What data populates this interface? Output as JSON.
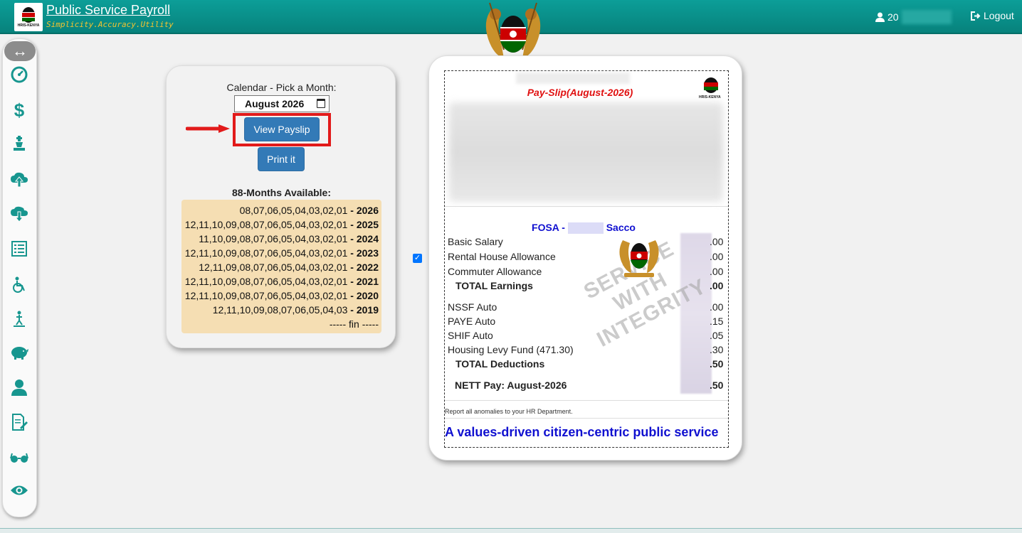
{
  "header": {
    "title": "Public Service Payroll",
    "tagline": "Simplicity.Accuracy.Utility",
    "user_prefix": "20",
    "logout_label": "Logout",
    "logo_text": "HRIS-KENYA"
  },
  "calendar": {
    "label": "Calendar - Pick a Month:",
    "month_value": "August 2026",
    "view_button": "View Payslip",
    "print_button": "Print it",
    "months_heading": "88-Months Available:",
    "months": [
      {
        "list": "08,07,06,05,04,03,02,01",
        "year": " - 2026"
      },
      {
        "list": "12,11,10,09,08,07,06,05,04,03,02,01",
        "year": " - 2025"
      },
      {
        "list": "11,10,09,08,07,06,05,04,03,02,01",
        "year": " - 2024"
      },
      {
        "list": "12,11,10,09,08,07,06,05,04,03,02,01",
        "year": " - 2023"
      },
      {
        "list": "12,11,09,08,07,06,05,04,03,02,01",
        "year": " - 2022"
      },
      {
        "list": "12,11,10,09,08,07,06,05,04,03,02,01",
        "year": " - 2021"
      },
      {
        "list": "12,11,10,09,08,07,06,05,04,03,02,01",
        "year": " - 2020"
      },
      {
        "list": "12,11,10,09,08,07,06,05,04,03",
        "year": " - 2019"
      }
    ],
    "fin": "----- fin -----"
  },
  "payslip": {
    "title": "Pay-Slip(August-2026)",
    "logo_text": "HRIS-KENYA",
    "fosa_prefix": "FOSA - ",
    "fosa_suffix": " Sacco",
    "watermark_lines": [
      "SERVICE",
      "WITH",
      "INTEGRITY"
    ],
    "earnings": [
      {
        "label": "Basic Salary",
        "amount": ".00"
      },
      {
        "label": "Rental House Allowance",
        "amount": ".00"
      },
      {
        "label": "Commuter Allowance",
        "amount": ".00"
      }
    ],
    "total_earnings": {
      "label": "TOTAL Earnings",
      "amount": ".00"
    },
    "deductions": [
      {
        "label": "NSSF Auto",
        "amount": ".00"
      },
      {
        "label": "PAYE Auto",
        "amount": ".15"
      },
      {
        "label": "SHIF Auto",
        "amount": ".05"
      },
      {
        "label": "Housing Levy Fund (471.30)",
        "amount": ".30"
      }
    ],
    "total_deductions": {
      "label": "TOTAL Deductions",
      "amount": ".50"
    },
    "nett": {
      "label": "NETT Pay: August-2026",
      "amount": ".50"
    },
    "report_note": "Report all anomalies to your HR Department.",
    "motto": "A values-driven citizen-centric public service"
  },
  "sidebar": {
    "icons": [
      "dashboard-icon",
      "dollar-icon",
      "chess-piece-icon",
      "cloud-upload-icon",
      "cloud-download-icon",
      "list-icon",
      "wheelchair-icon",
      "accessible-icon",
      "piggy-bank-icon",
      "user-icon",
      "edit-document-icon",
      "glasses-icon",
      "eye-icon"
    ]
  },
  "colors": {
    "header_teal": "#0c9e98",
    "accent_teal": "#17968f",
    "button_blue": "#337ab7",
    "highlight_red": "#e21a1a",
    "months_bg": "#f5deb3",
    "payslip_title_red": "#e01010",
    "fosa_blue": "#1010d0"
  }
}
